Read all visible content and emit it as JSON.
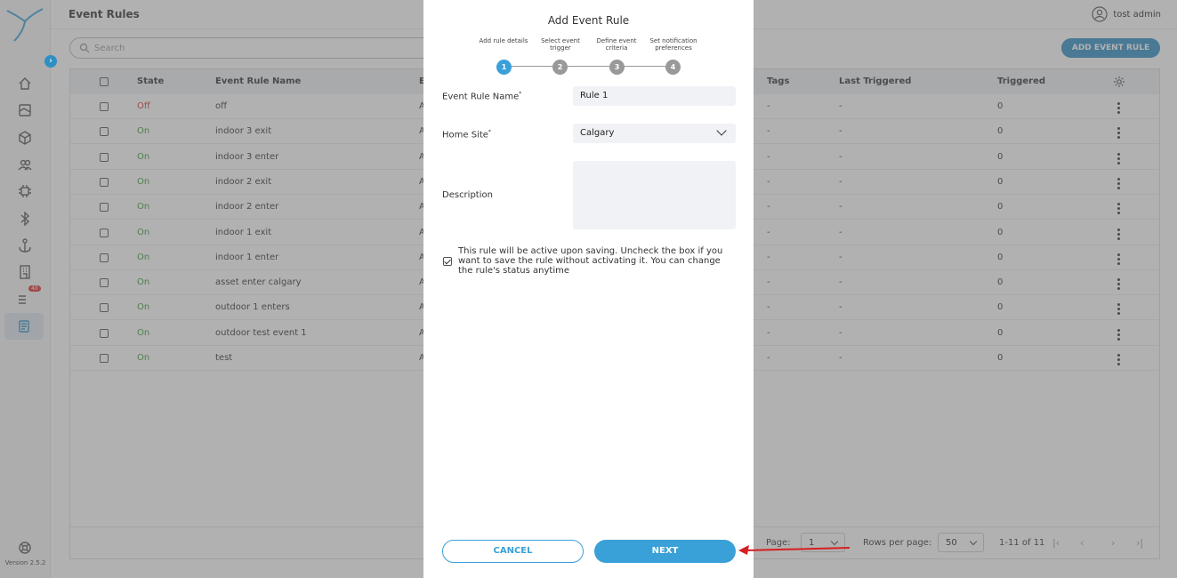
{
  "app": {
    "page_title": "Event Rules",
    "user_name": "tost admin",
    "version": "Version 2.5.2",
    "alerts_badge": "40",
    "colors": {
      "accent": "#2e8fc4",
      "on": "#3a9a3a",
      "off": "#d33333"
    }
  },
  "toolbar": {
    "search_placeholder": "Search",
    "add_button": "ADD EVENT RULE"
  },
  "table": {
    "headers": {
      "state": "State",
      "name": "Event Rule Name",
      "event": "E",
      "tags": "Tags",
      "last_triggered": "Last Triggered",
      "triggered": "Triggered"
    },
    "rows": [
      {
        "state": "Off",
        "name": "off",
        "event": "A",
        "tags": "-",
        "last": "-",
        "count": "0"
      },
      {
        "state": "On",
        "name": "indoor 3 exit",
        "event": "A",
        "tags": "-",
        "last": "-",
        "count": "0"
      },
      {
        "state": "On",
        "name": "indoor 3 enter",
        "event": "A",
        "tags": "-",
        "last": "-",
        "count": "0"
      },
      {
        "state": "On",
        "name": "indoor 2 exit",
        "event": "A",
        "tags": "-",
        "last": "-",
        "count": "0"
      },
      {
        "state": "On",
        "name": "indoor 2 enter",
        "event": "A",
        "tags": "-",
        "last": "-",
        "count": "0"
      },
      {
        "state": "On",
        "name": "indoor 1 exit",
        "event": "A",
        "tags": "-",
        "last": "-",
        "count": "0"
      },
      {
        "state": "On",
        "name": "indoor 1 enter",
        "event": "A",
        "tags": "-",
        "last": "-",
        "count": "0"
      },
      {
        "state": "On",
        "name": "asset enter calgary",
        "event": "A",
        "tags": "-",
        "last": "-",
        "count": "0"
      },
      {
        "state": "On",
        "name": "outdoor 1 enters",
        "event": "A",
        "tags": "-",
        "last": "-",
        "count": "0"
      },
      {
        "state": "On",
        "name": "outdoor test event 1",
        "event": "A",
        "tags": "-",
        "last": "-",
        "count": "0"
      },
      {
        "state": "On",
        "name": "test",
        "event": "A",
        "tags": "-",
        "last": "-",
        "count": "0"
      }
    ]
  },
  "pagination": {
    "page_label": "Page:",
    "page_value": "1",
    "rows_label": "Rows per page:",
    "rows_value": "50",
    "range": "1-11 of 11"
  },
  "modal": {
    "title": "Add Event Rule",
    "steps": [
      {
        "num": "1",
        "label": "Add rule details"
      },
      {
        "num": "2",
        "label": "Select event trigger"
      },
      {
        "num": "3",
        "label": "Define event criteria"
      },
      {
        "num": "4",
        "label": "Set notification preferences"
      }
    ],
    "name_label": "Event Rule Name",
    "name_value": "Rule 1",
    "site_label": "Home Site",
    "site_value": "Calgary",
    "description_label": "Description",
    "description_value": "",
    "required_mark": "*",
    "active_text": "This rule will be active upon saving. Uncheck the box if you want to save the rule without activating it. You can change the rule's status anytime",
    "cancel": "CANCEL",
    "next": "NEXT"
  }
}
